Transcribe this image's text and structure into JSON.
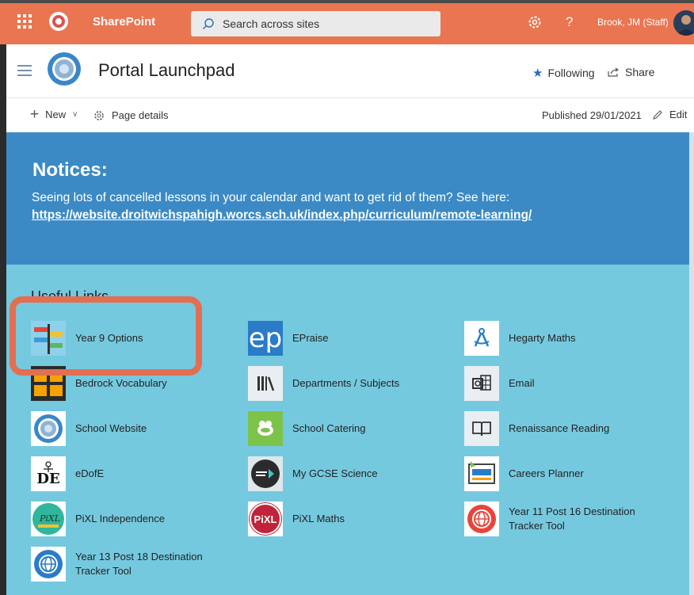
{
  "suitebar": {
    "app_name": "SharePoint",
    "search_placeholder": "Search across sites",
    "help": "?",
    "user": "Brook, JM (Staff)"
  },
  "site": {
    "title": "Portal Launchpad",
    "following": "Following",
    "share": "Share"
  },
  "commandbar": {
    "new": "New",
    "page_details": "Page details",
    "published": "Published 29/01/2021",
    "edit": "Edit"
  },
  "notices": {
    "heading": "Notices:",
    "text": "Seeing lots of cancelled lessons in your calendar and want to get rid of them?  See here: ",
    "link": "https://website.droitwichspahigh.worcs.sch.uk/index.php/curriculum/remote-learning/"
  },
  "links": {
    "title": "Useful Links",
    "items": [
      {
        "label": "Year 9 Options",
        "icon": "signpost-icon"
      },
      {
        "label": "EPraise",
        "icon": "epraise-icon"
      },
      {
        "label": "Hegarty Maths",
        "icon": "compass-icon"
      },
      {
        "label": "Bedrock Vocabulary",
        "icon": "bedrock-icon"
      },
      {
        "label": "Departments / Subjects",
        "icon": "books-icon"
      },
      {
        "label": "Email",
        "icon": "outlook-icon"
      },
      {
        "label": "School Website",
        "icon": "school-logo-icon"
      },
      {
        "label": "School Catering",
        "icon": "catering-icon"
      },
      {
        "label": "Renaissance Reading",
        "icon": "book-icon"
      },
      {
        "label": "eDofE",
        "icon": "dofe-icon"
      },
      {
        "label": "My GCSE Science",
        "icon": "gcse-science-icon"
      },
      {
        "label": "Careers Planner",
        "icon": "careers-icon"
      },
      {
        "label": "PiXL Independence",
        "icon": "pixl-independence-icon"
      },
      {
        "label": "PiXL Maths",
        "icon": "pixl-maths-icon"
      },
      {
        "label": "Year 11 Post 16 Destination Tracker Tool",
        "icon": "globe-red-icon"
      },
      {
        "label": "Year 13 Post 18 Destination Tracker Tool",
        "icon": "globe-blue-icon"
      }
    ],
    "pixl_text": "PiXL",
    "dofe_text": "DE",
    "ep_text": "ep"
  },
  "colors": {
    "suitebar": "#ea7551",
    "notices": "#3b8ac5",
    "links_bg": "#75c9df",
    "highlight": "#e26f52"
  }
}
